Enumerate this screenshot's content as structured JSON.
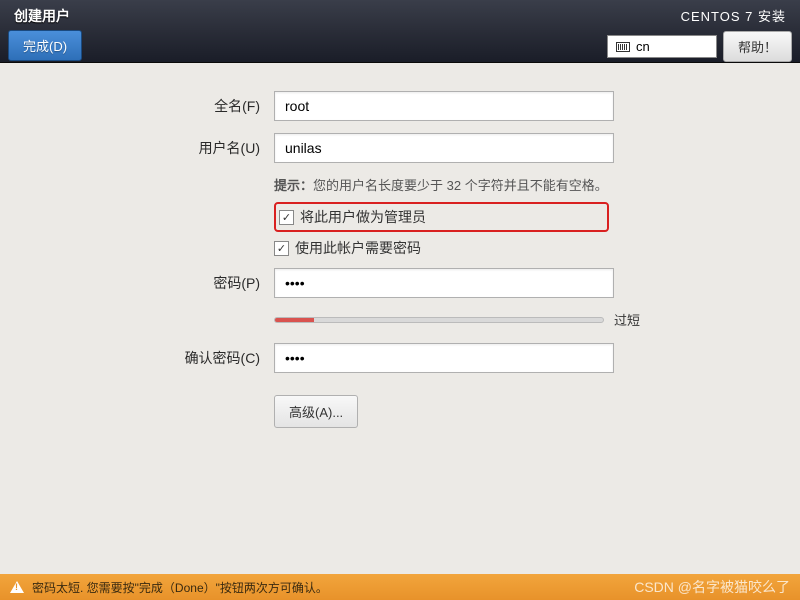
{
  "header": {
    "page_title": "创建用户",
    "done_button": "完成(D)",
    "installer_title": "CENTOS 7 安装",
    "lang_indicator": "cn",
    "help_button": "帮助！"
  },
  "form": {
    "fullname_label": "全名(F)",
    "fullname_value": "root",
    "username_label": "用户名(U)",
    "username_value": "unilas",
    "hint_prefix": "提示：",
    "hint_text": "您的用户名长度要少于 32 个字符并且不能有空格。",
    "admin_checkbox_label": "将此用户做为管理员",
    "admin_checked": true,
    "require_pw_label": "使用此帐户需要密码",
    "require_pw_checked": true,
    "password_label": "密码(P)",
    "password_value": "••••",
    "strength_text": "过短",
    "confirm_label": "确认密码(C)",
    "confirm_value": "••••",
    "advanced_button": "高级(A)..."
  },
  "footer": {
    "warning_text": "密码太短. 您需要按\"完成（Done）\"按钮两次方可确认。",
    "watermark": "CSDN @名字被猫咬么了"
  }
}
